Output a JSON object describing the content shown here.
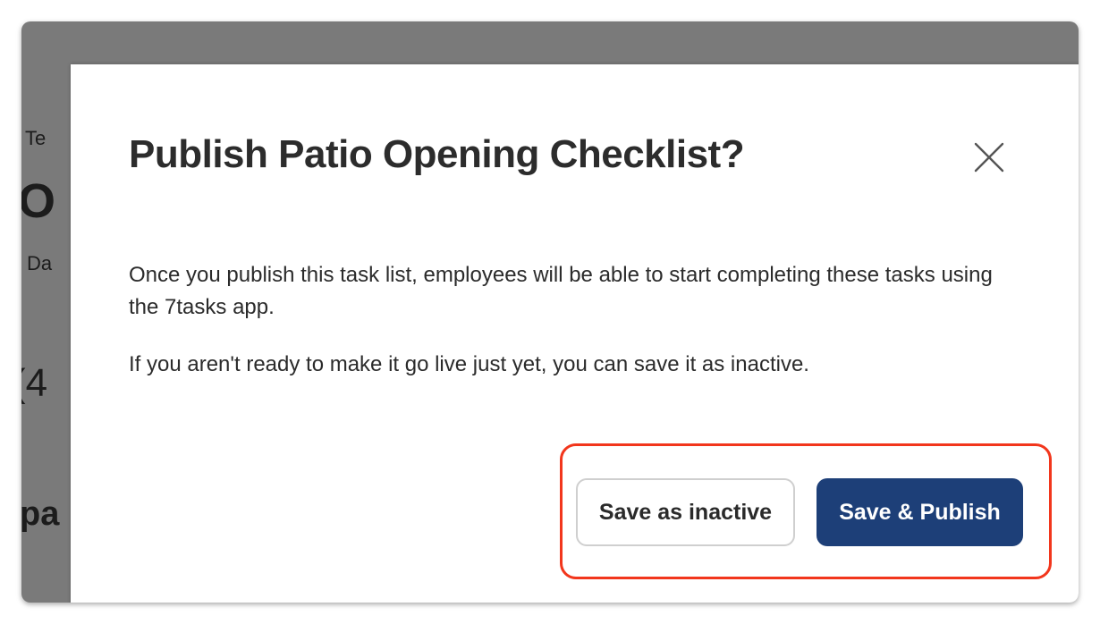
{
  "background": {
    "fragments": [
      "Te",
      "O",
      "Da",
      "(4",
      "pa"
    ]
  },
  "dialog": {
    "title": "Publish Patio Opening Checklist?",
    "close_icon": "close-icon",
    "paragraphs": [
      "Once you publish this task list, employees will be able to start completing these tasks using the 7tasks app.",
      "If you aren't ready to make it go live just yet, you can save it as inactive."
    ],
    "buttons": {
      "secondary_label": "Save as inactive",
      "primary_label": "Save & Publish"
    }
  },
  "colors": {
    "primary_button": "#1d3f78",
    "highlight": "#f2361c",
    "overlay": "#7a7a7a"
  }
}
